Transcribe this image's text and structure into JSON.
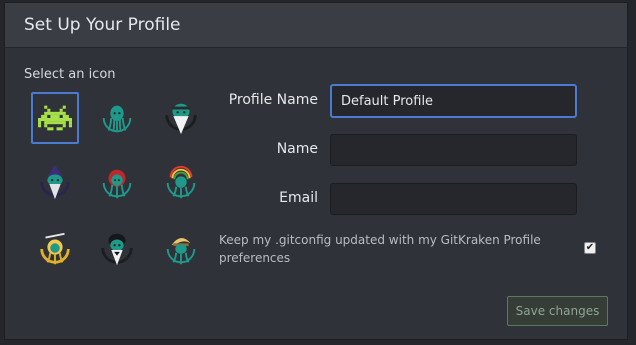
{
  "dialog": {
    "title": "Set Up Your Profile",
    "select_icon_label": "Select an icon"
  },
  "icons": [
    {
      "name": "space-invader-icon",
      "selected": true
    },
    {
      "name": "kraken-teal-icon",
      "selected": false
    },
    {
      "name": "kraken-beard-icon",
      "selected": false
    },
    {
      "name": "kraken-wizard-icon",
      "selected": false
    },
    {
      "name": "kraken-red-hood-icon",
      "selected": false
    },
    {
      "name": "kraken-rainbow-icon",
      "selected": false
    },
    {
      "name": "kraken-gold-icon",
      "selected": false
    },
    {
      "name": "kraken-tuxedo-icon",
      "selected": false
    },
    {
      "name": "kraken-blonde-icon",
      "selected": false
    }
  ],
  "form": {
    "profile_name_label": "Profile Name",
    "profile_name_value": "Default Profile",
    "name_label": "Name",
    "name_value": "",
    "email_label": "Email",
    "email_value": ""
  },
  "gitconfig": {
    "text": "Keep my .gitconfig updated with my GitKraken Profile preferences",
    "checked": true
  },
  "buttons": {
    "save_label": "Save changes"
  },
  "colors": {
    "accent_blue": "#4a7bd1",
    "save_border": "#5a7a5f",
    "invader_green": "#a8e04a",
    "kraken_teal": "#1f9a8a"
  }
}
